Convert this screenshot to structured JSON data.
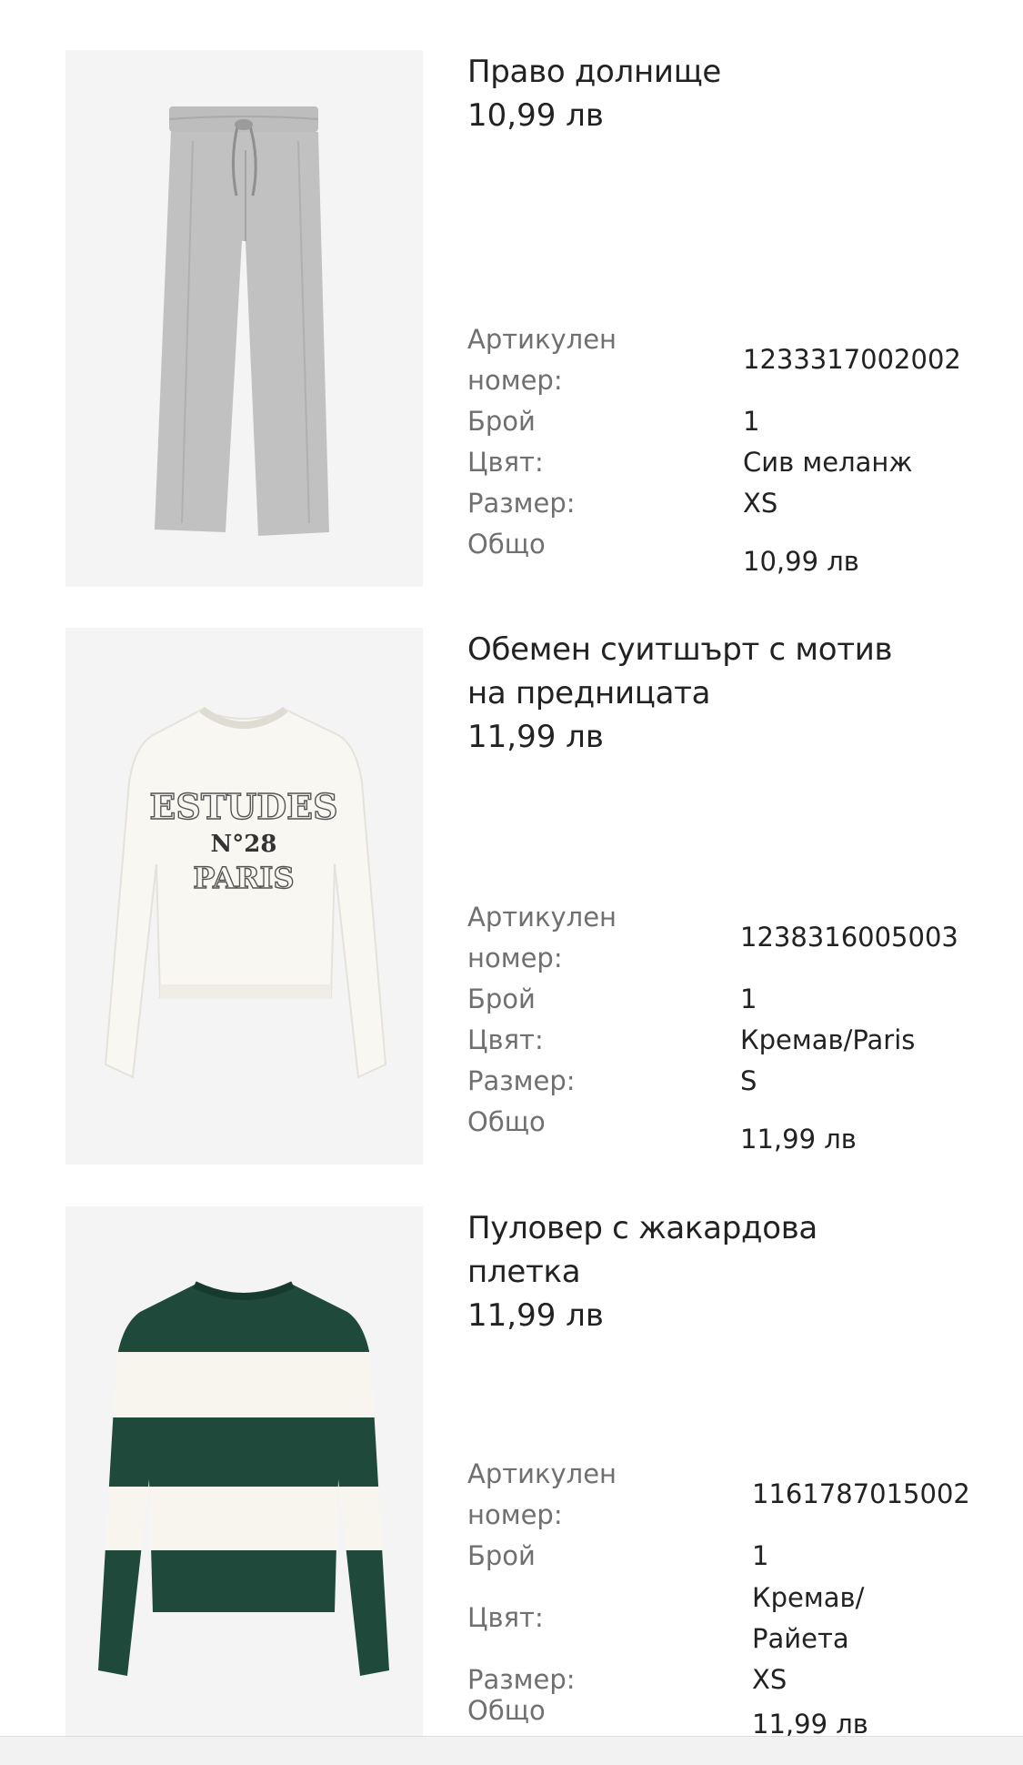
{
  "items": [
    {
      "title": "Право долнище",
      "price": "10,99 лв",
      "image_desc_icon": "grey-trousers-image",
      "labels": {
        "article_line1": "Артикулен",
        "article_line2": "номер:",
        "qty": "Брой",
        "color": "Цвят:",
        "size": "Размер:",
        "total": "Общо"
      },
      "values": {
        "article": "1233317002002",
        "qty": "1",
        "color_line1": "Сив меланж",
        "color_line2": "",
        "size": "XS",
        "total": "10,99 лв"
      }
    },
    {
      "title_line1": "Обемен суитшърт с мотив",
      "title_line2": "на предницата",
      "price": "11,99 лв",
      "image_desc_icon": "white-sweatshirt-image",
      "print_text": [
        "ESTUDES",
        "N°28",
        "PARIS"
      ],
      "labels": {
        "article_line1": "Артикулен",
        "article_line2": "номер:",
        "qty": "Брой",
        "color": "Цвят:",
        "size": "Размер:",
        "total": "Общо"
      },
      "values": {
        "article": "1238316005003",
        "qty": "1",
        "color_line1": "Кремав/Paris",
        "size": "S",
        "total": "11,99 лв"
      }
    },
    {
      "title_line1": "Пуловер с жакардова",
      "title_line2": "плетка",
      "price": "11,99 лв",
      "image_desc_icon": "striped-sweater-image",
      "labels": {
        "article_line1": "Артикулен",
        "article_line2": "номер:",
        "qty": "Брой",
        "color": "Цвят:",
        "size": "Размер:",
        "total": "Общо"
      },
      "values": {
        "article": "1161787015002",
        "qty": "1",
        "color_line1": "Кремав/",
        "color_line2": "Райета",
        "size": "XS",
        "total": "11,99 лв"
      }
    }
  ],
  "colors": {
    "text_primary": "#222222",
    "text_secondary": "#707070",
    "image_bg": "#f4f4f4",
    "trousers_grey": "#b9b9b9",
    "sweater_green": "#1f4a3b",
    "sweater_cream": "#f7f5ee"
  }
}
